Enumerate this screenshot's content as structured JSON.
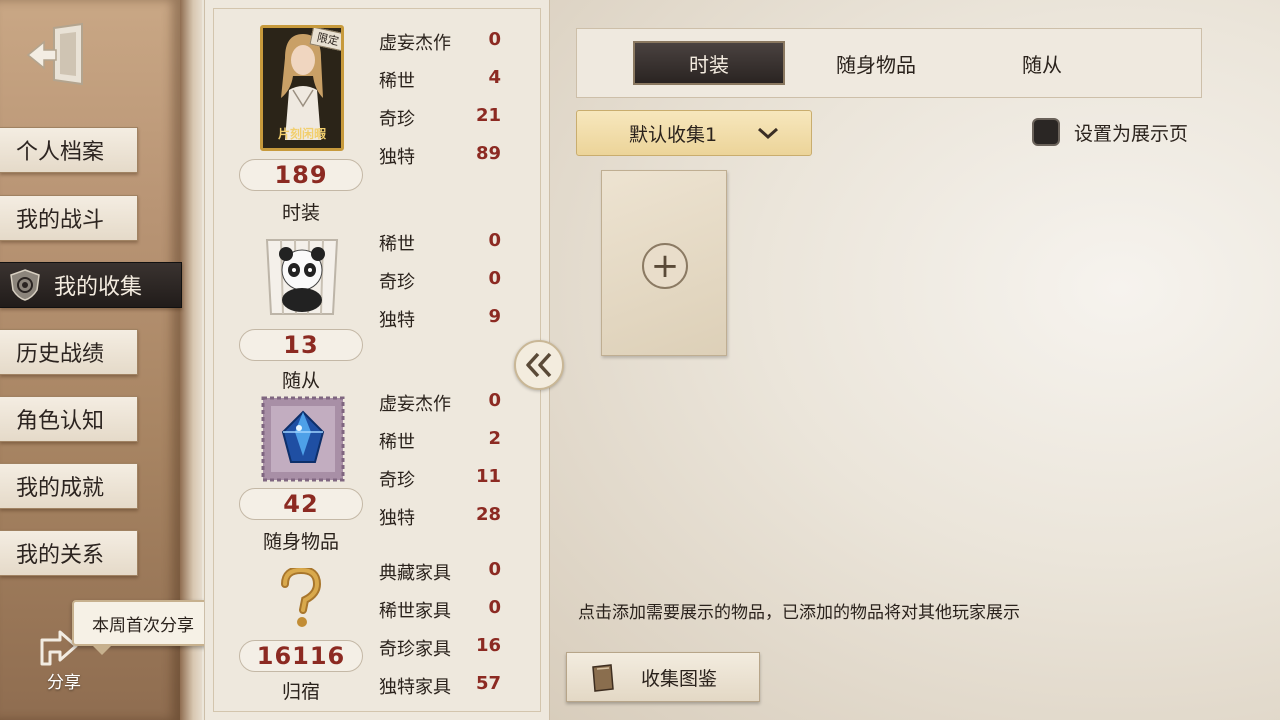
{
  "sidebar": {
    "items": [
      {
        "label": "个人档案"
      },
      {
        "label": "我的战斗"
      },
      {
        "label": "我的收集",
        "active": true
      },
      {
        "label": "历史战绩"
      },
      {
        "label": "角色认知"
      },
      {
        "label": "我的成就"
      },
      {
        "label": "我的关系"
      }
    ],
    "share_bubble": "本周首次分享",
    "share_label": "分享"
  },
  "stats": {
    "costume": {
      "badge": "限定",
      "card_caption": "片刻闲暇",
      "count": "189",
      "label": "时装",
      "rarities": [
        {
          "name": "虚妄杰作",
          "value": "0"
        },
        {
          "name": "稀世",
          "value": "4"
        },
        {
          "name": "奇珍",
          "value": "21"
        },
        {
          "name": "独特",
          "value": "89"
        }
      ]
    },
    "pet": {
      "count": "13",
      "label": "随从",
      "rarities": [
        {
          "name": "稀世",
          "value": "0"
        },
        {
          "name": "奇珍",
          "value": "0"
        },
        {
          "name": "独特",
          "value": "9"
        }
      ]
    },
    "accessory": {
      "count": "42",
      "label": "随身物品",
      "rarities": [
        {
          "name": "虚妄杰作",
          "value": "0"
        },
        {
          "name": "稀世",
          "value": "2"
        },
        {
          "name": "奇珍",
          "value": "11"
        },
        {
          "name": "独特",
          "value": "28"
        }
      ]
    },
    "home": {
      "count": "16116",
      "label": "归宿",
      "rarities": [
        {
          "name": "典藏家具",
          "value": "0"
        },
        {
          "name": "稀世家具",
          "value": "0"
        },
        {
          "name": "奇珍家具",
          "value": "16"
        },
        {
          "name": "独特家具",
          "value": "57"
        }
      ]
    }
  },
  "tabs": [
    {
      "label": "时装",
      "active": true
    },
    {
      "label": "随身物品"
    },
    {
      "label": "随从"
    }
  ],
  "dropdown": {
    "selected": "默认收集1"
  },
  "showcase_checkbox": {
    "label": "设置为展示页",
    "checked": false
  },
  "hint": "点击添加需要展示的物品，已添加的物品将对其他玩家展示",
  "gallery_button": "收集图鉴",
  "colors": {
    "accent_red": "#8c2a22",
    "active_tab": "#2a2422",
    "dropdown_gold": "#ecd499"
  }
}
